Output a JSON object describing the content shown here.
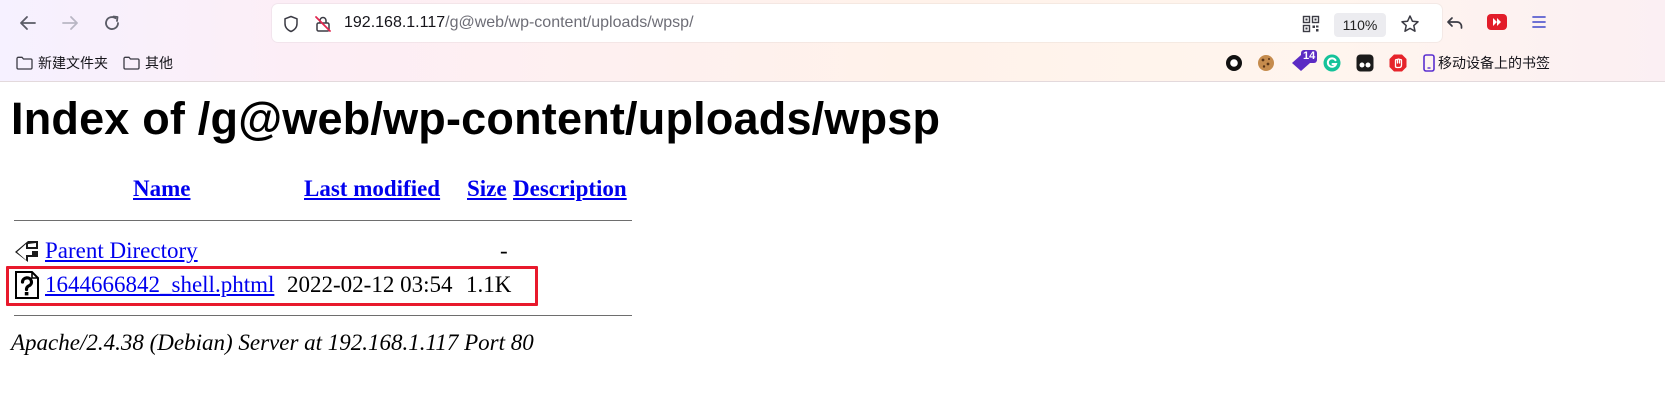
{
  "browser": {
    "url_host": "192.168.1.117",
    "url_path": "/g@web/wp-content/uploads/wpsp/",
    "zoom": "110%",
    "ext_badge": "14",
    "bookmarks": [
      {
        "label": "新建文件夹",
        "icon": "folder-icon"
      },
      {
        "label": "其他",
        "icon": "folder-icon"
      }
    ],
    "mobile_bookmarks": "移动设备上的书签"
  },
  "page": {
    "title": "Index of /g@web/wp-content/uploads/wpsp",
    "columns": {
      "name": "Name",
      "last_modified": "Last modified",
      "size": "Size",
      "description": "Description"
    },
    "rows": [
      {
        "name": "Parent Directory",
        "modified": "",
        "size": "-",
        "icon": "back-arrow-icon"
      },
      {
        "name": "1644666842_shell.phtml",
        "modified": "2022-02-12 03:54",
        "size": "1.1K",
        "icon": "unknown-file-icon"
      }
    ],
    "address": "Apache/2.4.38 (Debian) Server at 192.168.1.117 Port 80"
  },
  "colors": {
    "link": "#0000ee",
    "highlight": "#e8192c"
  }
}
